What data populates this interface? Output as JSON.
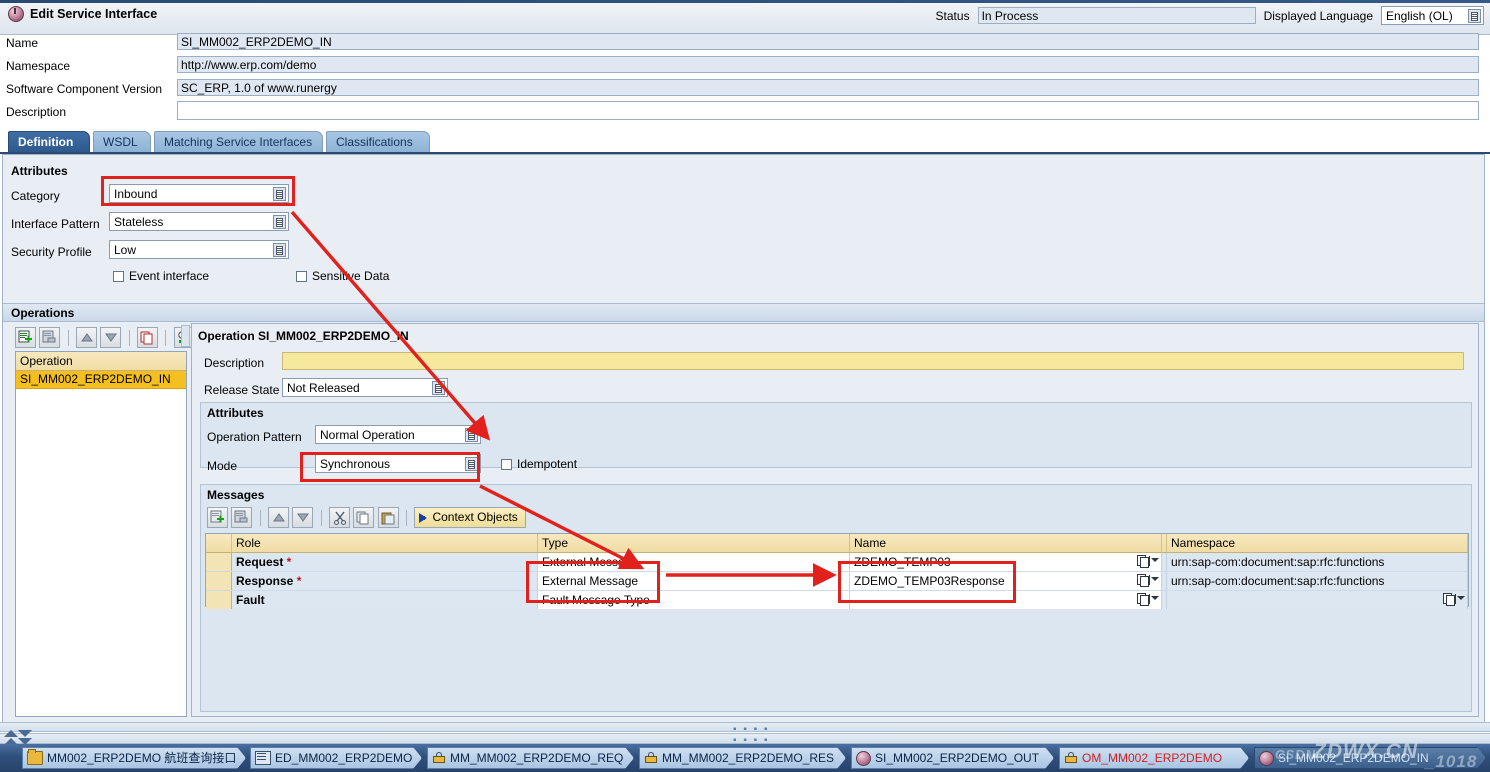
{
  "window": {
    "title": "Edit Service Interface",
    "title_icon": "service-interface-sphere-icon"
  },
  "header": {
    "status_label": "Status",
    "status_value": "In Process",
    "language_label": "Displayed Language",
    "language_value": "English (OL)"
  },
  "form": {
    "name_label": "Name",
    "name_value": "SI_MM002_ERP2DEMO_IN",
    "namespace_label": "Namespace",
    "namespace_value": "http://www.erp.com/demo",
    "scv_label": "Software Component Version",
    "scv_value": "SC_ERP, 1.0 of www.runergy",
    "description_label": "Description",
    "description_value": ""
  },
  "tabs": [
    {
      "label": "Definition",
      "active": true
    },
    {
      "label": "WSDL",
      "active": false
    },
    {
      "label": "Matching Service Interfaces",
      "active": false
    },
    {
      "label": "Classifications",
      "active": false
    }
  ],
  "attributes": {
    "section_title": "Attributes",
    "category_label": "Category",
    "category_value": "Inbound",
    "pattern_label": "Interface Pattern",
    "pattern_value": "Stateless",
    "security_label": "Security Profile",
    "security_value": "Low",
    "event_interface_label": "Event interface",
    "event_interface_checked": false,
    "sensitive_data_label": "Sensitive Data",
    "sensitive_data_checked": false
  },
  "operations": {
    "section_title": "Operations",
    "toolbar": [
      {
        "name": "create-operation-icon",
        "glyph": "create"
      },
      {
        "name": "delete-operation-icon",
        "glyph": "delete"
      },
      {
        "name": "move-up-icon",
        "glyph": "up"
      },
      {
        "name": "move-down-icon",
        "glyph": "down"
      },
      {
        "name": "copy-icon",
        "glyph": "copy"
      },
      {
        "name": "where-used-icon",
        "glyph": "whereused"
      }
    ],
    "list_header": "Operation",
    "list_rows": [
      "SI_MM002_ERP2DEMO_IN"
    ]
  },
  "detail": {
    "title": "Operation SI_MM002_ERP2DEMO_IN",
    "description_label": "Description",
    "description_value": "",
    "release_state_label": "Release State",
    "release_state_value": "Not Released",
    "attributes_title": "Attributes",
    "operation_pattern_label": "Operation Pattern",
    "operation_pattern_value": "Normal Operation",
    "mode_label": "Mode",
    "mode_value": "Synchronous",
    "idempotent_label": "Idempotent",
    "idempotent_checked": false
  },
  "messages": {
    "section_title": "Messages",
    "toolbar": [
      {
        "name": "insert-row-icon",
        "glyph": "create"
      },
      {
        "name": "delete-row-icon",
        "glyph": "delete"
      },
      {
        "name": "move-up-icon",
        "glyph": "up"
      },
      {
        "name": "move-down-icon",
        "glyph": "down"
      },
      {
        "name": "cut-icon",
        "glyph": "cut"
      },
      {
        "name": "copy-icon",
        "glyph": "copy"
      },
      {
        "name": "paste-icon",
        "glyph": "paste"
      }
    ],
    "context_objects_label": "Context Objects",
    "columns": [
      "",
      "Role",
      "Type",
      "Name",
      "",
      "Namespace"
    ],
    "rows": [
      {
        "role": "Request",
        "required": true,
        "type": "External Message",
        "name": "ZDEMO_TEMP03",
        "namespace": "urn:sap-com:document:sap:rfc:functions"
      },
      {
        "role": "Response",
        "required": true,
        "type": "External Message",
        "name": "ZDEMO_TEMP03Response",
        "namespace": "urn:sap-com:document:sap:rfc:functions"
      },
      {
        "role": "Fault",
        "required": false,
        "type": "Fault Message Type",
        "name": "",
        "namespace": ""
      }
    ]
  },
  "taskbar": {
    "items": [
      {
        "label": "MM002_ERP2DEMO 航班查询接口",
        "icon": "folder-icon",
        "style": "light"
      },
      {
        "label": "ED_MM002_ERP2DEMO",
        "icon": "document-icon",
        "style": "light"
      },
      {
        "label": "MM_MM002_ERP2DEMO_REQ",
        "icon": "lock-icon",
        "style": "light"
      },
      {
        "label": "MM_MM002_ERP2DEMO_RES",
        "icon": "lock-icon",
        "style": "light"
      },
      {
        "label": "SI_MM002_ERP2DEMO_OUT",
        "icon": "sphere-icon",
        "style": "light"
      },
      {
        "label": "OM_MM002_ERP2DEMO",
        "icon": "lock-icon",
        "style": "red"
      },
      {
        "label": "SI_MM002_ERP2DEMO_IN",
        "icon": "sphere-icon",
        "style": "dark"
      }
    ]
  },
  "watermark": {
    "text": "ZDWX.CN",
    "sub": "CSDN",
    "suffix": "_1018"
  },
  "colors": {
    "accent": "#2a4a74",
    "annotation": "#e2211c",
    "selected_row": "#f5bf1f",
    "yellow_field": "#f7e8a0",
    "header_gold": "#f0dda6"
  }
}
